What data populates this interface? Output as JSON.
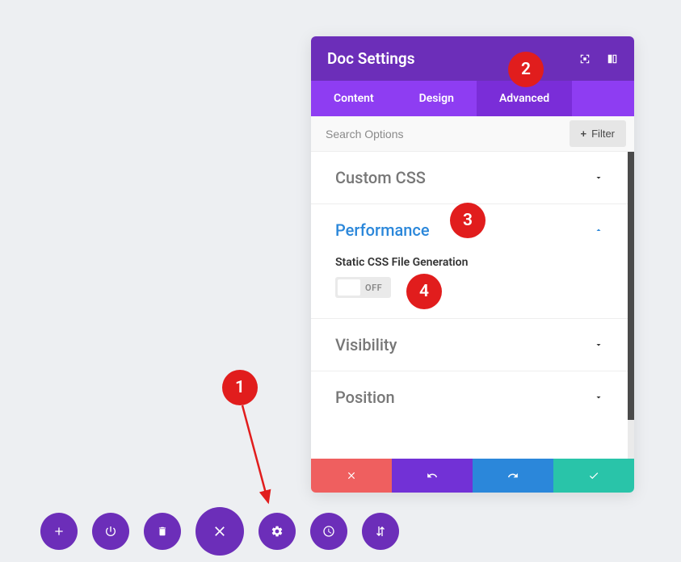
{
  "panel": {
    "title": "Doc Settings",
    "tabs": [
      {
        "label": "Content"
      },
      {
        "label": "Design"
      },
      {
        "label": "Advanced"
      }
    ],
    "search_placeholder": "Search Options",
    "filter_label": "Filter"
  },
  "sections": {
    "custom_css": {
      "title": "Custom CSS"
    },
    "performance": {
      "title": "Performance",
      "setting_label": "Static CSS File Generation",
      "toggle_value": "OFF"
    },
    "visibility": {
      "title": "Visibility"
    },
    "position": {
      "title": "Position"
    }
  },
  "callouts": {
    "c1": "1",
    "c2": "2",
    "c3": "3",
    "c4": "4"
  },
  "colors": {
    "primary": "#6c2eb9",
    "danger": "#e11d1d",
    "red": "#ef5f5f",
    "blue": "#2b87da",
    "green": "#29c4a9"
  }
}
